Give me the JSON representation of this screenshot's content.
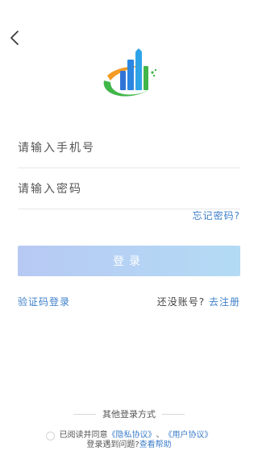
{
  "nav": {
    "back_icon": "chevron-left-icon"
  },
  "logo": {
    "icon": "city-buildings-logo",
    "colors": {
      "green": "#41b64a",
      "blue": "#2f73d6",
      "orange": "#f39b24"
    }
  },
  "form": {
    "phone_placeholder": "请输入手机号",
    "password_placeholder": "请输入密码",
    "forgot_label": "忘记密码?",
    "login_label": "登录",
    "sms_login_label": "验证码登录",
    "no_account_label": "还没账号? ",
    "register_label": "去注册"
  },
  "footer": {
    "other_login_label": "其他登录方式",
    "agree_prefix": "已阅读并同意",
    "privacy_label": "《隐私协议》",
    "separator": "、",
    "user_agreement_label": "《用户协议》",
    "help_prefix": "登录遇到问题?",
    "help_link": "查看帮助"
  },
  "colors": {
    "link": "#3e7fc9",
    "button_gradient_start": "#b7c9f3",
    "button_gradient_end": "#b3dbf5"
  }
}
